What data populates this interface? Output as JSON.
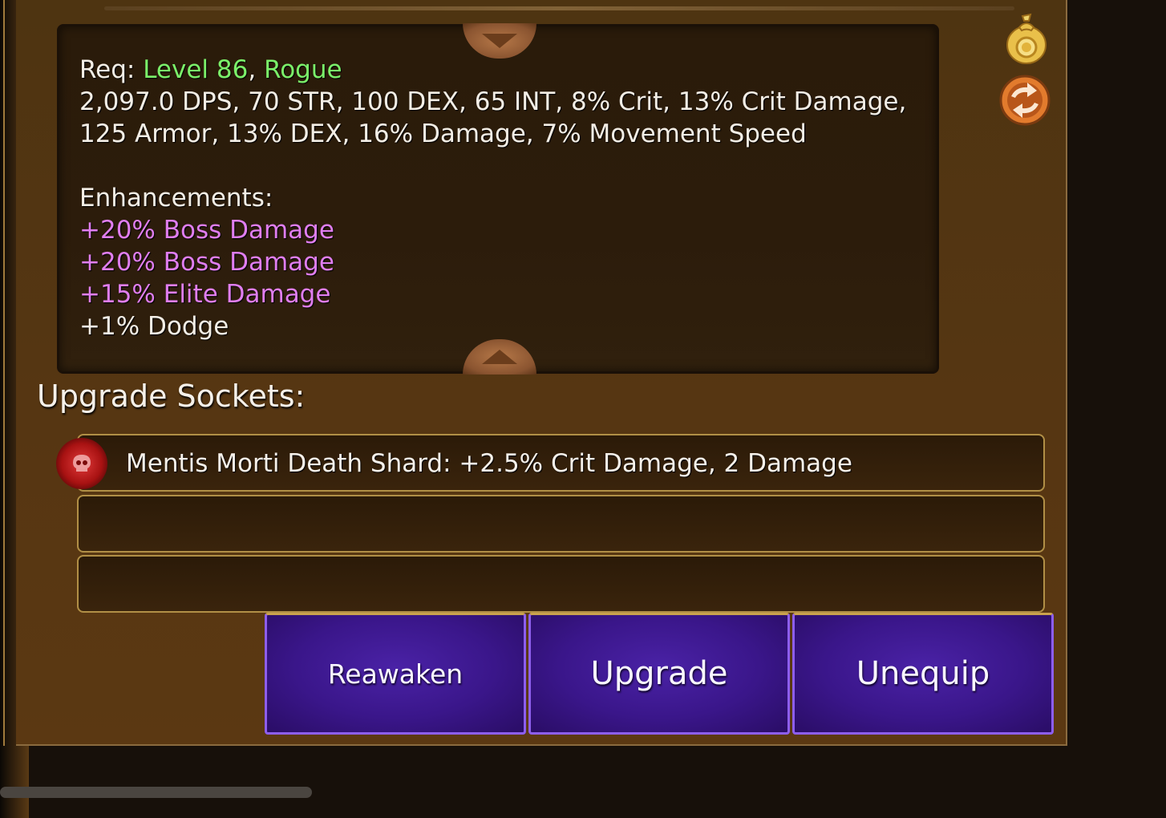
{
  "stats": {
    "req_prefix": "Req: ",
    "req_level": "Level 86",
    "req_sep": ", ",
    "req_class": "Rogue",
    "line_1": "2,097.0 DPS, 70 STR, 100 DEX, 65 INT, 8% Crit, 13% Crit Damage,",
    "line_2": "125 Armor, 13% DEX, 16% Damage, 7% Movement Speed",
    "enhancements_title": "Enhancements:",
    "enhancements": [
      "+20% Boss Damage",
      "+20% Boss Damage",
      "+15% Elite Damage",
      "+1% Dodge"
    ]
  },
  "sockets": {
    "title": "Upgrade Sockets:",
    "slots": [
      "Mentis Morti Death Shard: +2.5% Crit Damage, 2 Damage",
      "",
      ""
    ]
  },
  "buttons": {
    "reawaken": "Reawaken",
    "upgrade": "Upgrade",
    "unequip": "Unequip"
  },
  "icons": {
    "scroll_up": "chevron-down-icon",
    "scroll_down": "chevron-up-icon",
    "gold_bag": "gold-bag-icon",
    "swap": "swap-icon",
    "gem": "skull-gem-icon"
  },
  "colors": {
    "requirement": "#7bf06a",
    "enhancement": "#e07ef0",
    "button": "#3a168a"
  }
}
